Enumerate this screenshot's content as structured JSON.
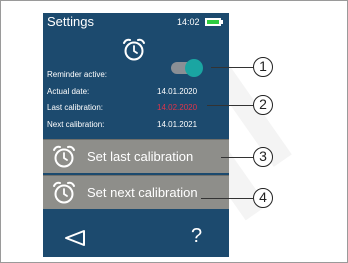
{
  "screen": {
    "title": "Settings",
    "time": "14:02"
  },
  "rows": [
    {
      "label": "Reminder active:",
      "value": ""
    },
    {
      "label": "Actual date:",
      "value": "14.01.2020"
    },
    {
      "label": "Last calibration:",
      "value": "14.02.2020"
    },
    {
      "label": "Next calibration:",
      "value": "14.01.2021"
    }
  ],
  "toggle": {
    "on": true
  },
  "buttons": [
    {
      "label": "Set last calibration"
    },
    {
      "label": "Set next calibration"
    }
  ],
  "footer": {
    "help": "?"
  },
  "callouts": [
    "1",
    "2",
    "3",
    "4"
  ],
  "colors": {
    "screen_bg": "#1c4a6e",
    "button_bg": "#8e8e8a",
    "highlight_date": "#e0344a",
    "toggle_knob": "#1aa5a2",
    "battery": "#2ecc40"
  },
  "icons": [
    "alarm-clock-icon",
    "back-arrow-icon",
    "battery-icon"
  ]
}
